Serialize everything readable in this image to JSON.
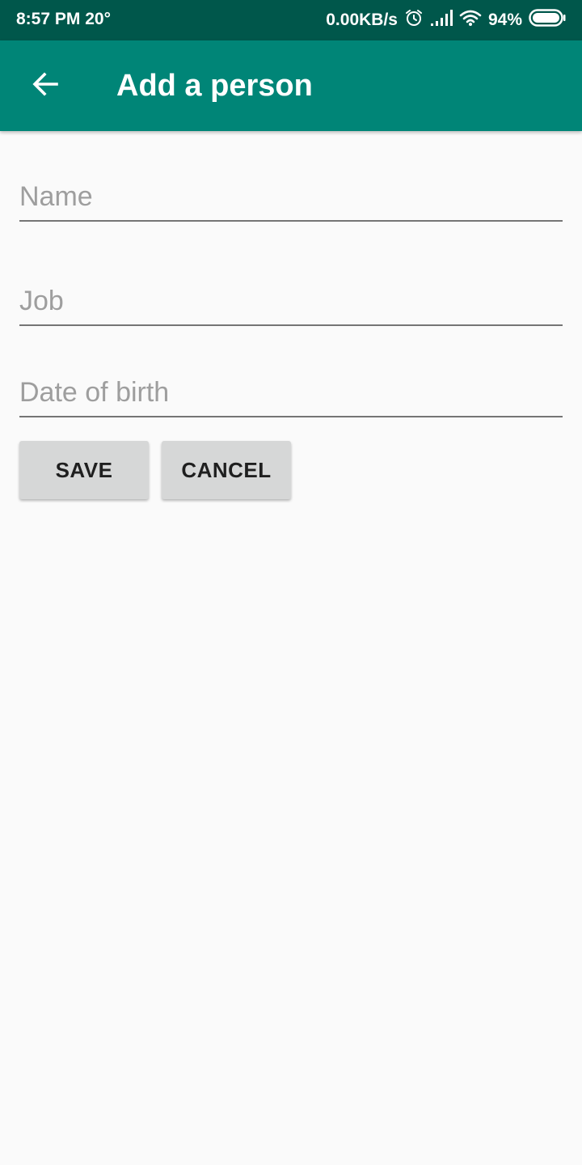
{
  "status_bar": {
    "time": "8:57 PM",
    "temperature": "20°",
    "network_speed": "0.00KB/s",
    "battery_percent": "94%",
    "icons": [
      "alarm-icon",
      "signal-icon",
      "wifi-icon",
      "battery-icon"
    ]
  },
  "app_bar": {
    "title": "Add a person",
    "back_icon": "arrow-back-icon"
  },
  "form": {
    "name": {
      "placeholder": "Name",
      "value": ""
    },
    "job": {
      "placeholder": "Job",
      "value": ""
    },
    "dob": {
      "placeholder": "Date of birth",
      "value": ""
    }
  },
  "buttons": {
    "save_label": "SAVE",
    "cancel_label": "CANCEL"
  },
  "colors": {
    "status_bar": "#00574b",
    "app_bar": "#008577",
    "background": "#fafafa",
    "button": "#d6d7d7"
  }
}
